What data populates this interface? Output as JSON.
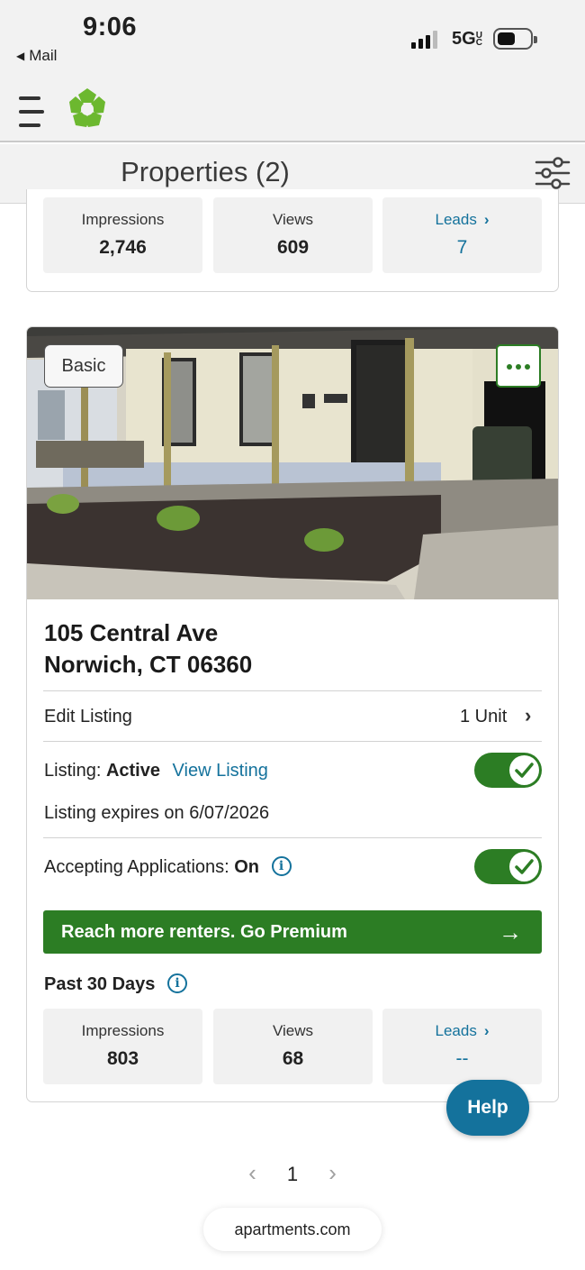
{
  "status_bar": {
    "time": "9:06",
    "back_app": "Mail",
    "network": "5G",
    "network_suffix": "UC"
  },
  "header": {
    "title": "Properties (2)",
    "icons": {
      "menu": "hamburger-icon",
      "logo": "apartments-logo",
      "filter": "sliders-icon"
    }
  },
  "previous_card": {
    "stats": {
      "impressions_label": "Impressions",
      "impressions": "2,746",
      "views_label": "Views",
      "views": "609",
      "leads_label": "Leads",
      "leads": "7"
    }
  },
  "listing": {
    "badge": "Basic",
    "address_line1": "105 Central Ave",
    "address_line2": "Norwich, CT 06360",
    "edit_label": "Edit Listing",
    "unit_count": "1 Unit",
    "listing_label": "Listing:",
    "listing_status": "Active",
    "view_listing": "View Listing",
    "listing_on": true,
    "expires": "Listing expires on 6/07/2026",
    "applications_label": "Accepting Applications:",
    "applications_status": "On",
    "applications_on": true,
    "premium_cta": "Reach more renters. Go Premium",
    "period_label": "Past 30 Days",
    "stats": {
      "impressions_label": "Impressions",
      "impressions": "803",
      "views_label": "Views",
      "views": "68",
      "leads_label": "Leads",
      "leads": "--"
    }
  },
  "help_label": "Help",
  "pagination": {
    "current": "1"
  },
  "url": "apartments.com",
  "colors": {
    "brand_green": "#2c7d24",
    "link_blue": "#14729c",
    "logo_green": "#6cb82f"
  }
}
